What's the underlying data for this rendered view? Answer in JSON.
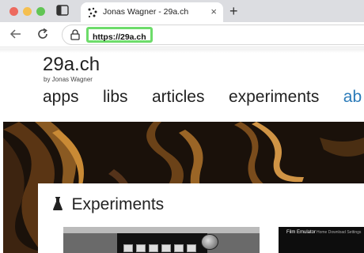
{
  "browser": {
    "tab": {
      "title": "Jonas Wagner - 29a.ch",
      "favicon": "dots-favicon-icon"
    },
    "address": {
      "url": "https://29a.ch"
    },
    "highlight_color": "#6ddc6a"
  },
  "site": {
    "title": "29a.ch",
    "subtitle": "by Jonas Wagner",
    "nav": [
      "apps",
      "libs",
      "articles",
      "experiments",
      "ab"
    ]
  },
  "section": {
    "title": "Experiments",
    "icon": "flask-icon"
  },
  "thumbnails": {
    "first": {
      "label": "",
      "dial_label": ""
    },
    "second": {
      "title": "Film Emulator",
      "links": "Home  Download  Settings"
    }
  }
}
